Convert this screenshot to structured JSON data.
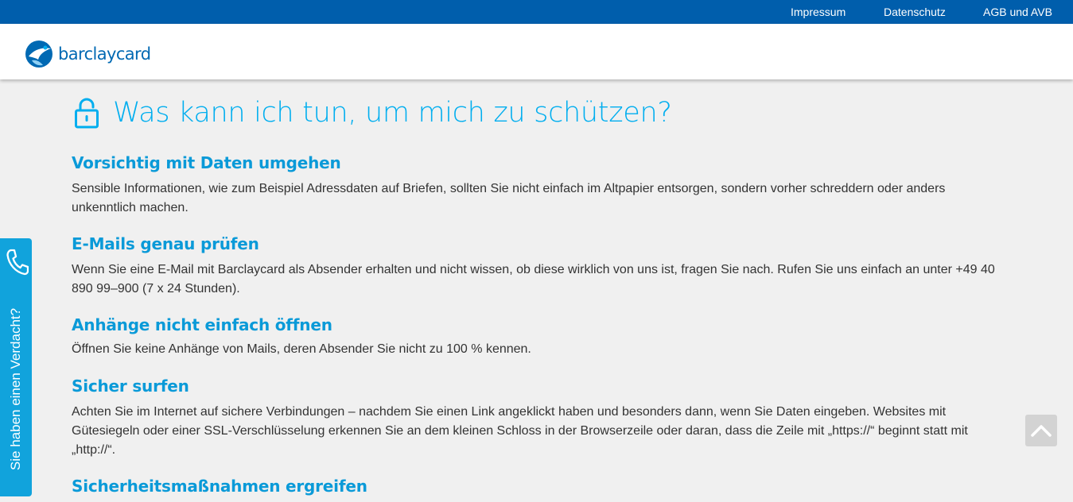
{
  "topbar": {
    "links": [
      "Impressum",
      "Datenschutz",
      "AGB und AVB"
    ]
  },
  "header": {
    "logo_text": "barclaycard"
  },
  "main": {
    "title": "Was kann ich tun, um mich zu schützen?",
    "sections": [
      {
        "heading": "Vorsichtig mit Daten umgehen",
        "text": "Sensible Informationen, wie zum Beispiel Adressdaten auf Briefen, sollten Sie nicht einfach im Altpapier entsorgen, sondern vorher schreddern oder anders unkenntlich machen."
      },
      {
        "heading": "E-Mails genau prüfen",
        "text": "Wenn Sie eine E-Mail mit Barclaycard als Absender erhalten und nicht wissen, ob diese wirklich von uns ist, fragen Sie nach. Rufen Sie uns einfach an unter +49 40 890 99–900 (7 x 24 Stunden)."
      },
      {
        "heading": "Anhänge nicht einfach öffnen",
        "text": "Öffnen Sie keine Anhänge von Mails, deren Absender Sie nicht zu 100 % kennen."
      },
      {
        "heading": "Sicher surfen",
        "text": "Achten Sie im Internet auf sichere Verbindungen – nachdem Sie einen Link angeklickt haben und besonders dann, wenn Sie Daten eingeben. Websites mit Gütesiegeln oder einer SSL-Verschlüsselung erkennen Sie an dem kleinen Schloss in der Browserzeile oder daran, dass die Zeile mit „https://“ beginnt statt mit „http://“."
      },
      {
        "heading": "Sicherheitsmaßnahmen ergreifen",
        "text": ""
      }
    ]
  },
  "side_tab": {
    "label": "Sie haben einen Verdacht?",
    "icon": "phone-icon"
  },
  "back_to_top": {
    "icon": "chevron-up-icon"
  },
  "colors": {
    "topbar": "#005eac",
    "accent": "#00aeef",
    "heading": "#0a9ad8",
    "logo": "#0069b3",
    "side_tab": "#11a3dc"
  }
}
